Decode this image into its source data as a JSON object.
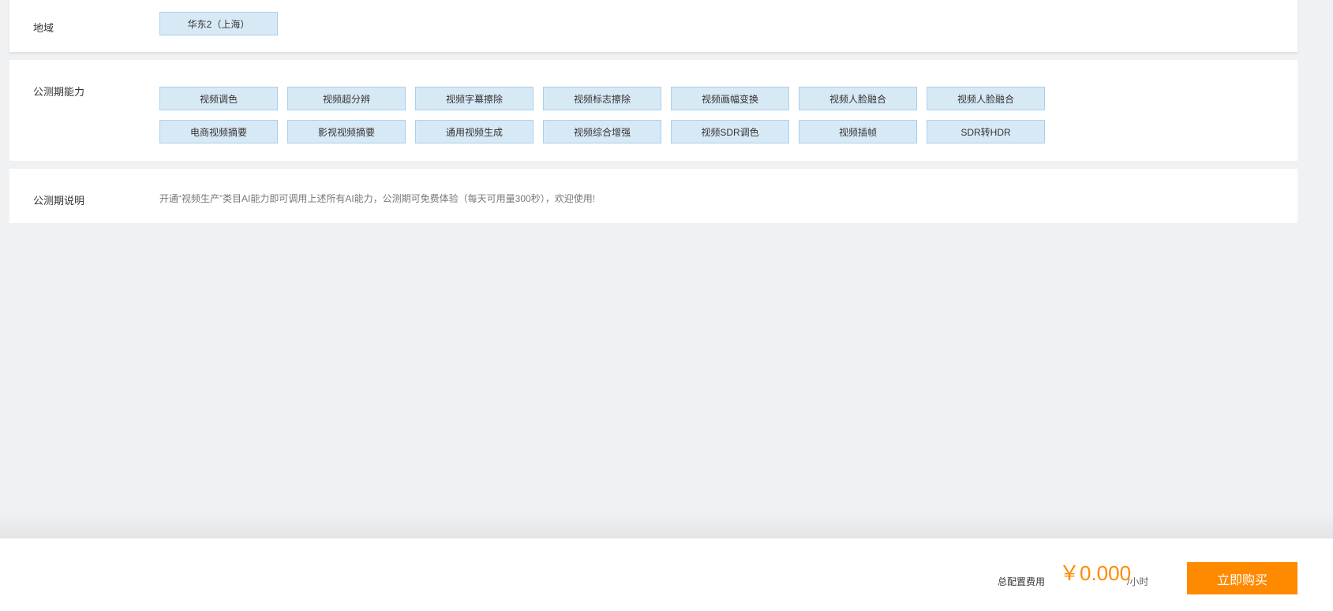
{
  "region": {
    "label": "地域",
    "selected": "华东2（上海）"
  },
  "abilities": {
    "label": "公测期能力",
    "options": [
      "视频调色",
      "视频超分辨",
      "视频字幕擦除",
      "视频标志擦除",
      "视频画幅变换",
      "视频人脸融合",
      "视频人脸融合",
      "电商视频摘要",
      "影视视频摘要",
      "通用视频生成",
      "视频综合增强",
      "视频SDR调色",
      "视频插帧",
      "SDR转HDR"
    ]
  },
  "notice": {
    "label": "公测期说明",
    "text": "开通“视频生产”类目AI能力即可调用上述所有AI能力，公测期可免费体验（每天可用量300秒），欢迎使用!"
  },
  "footer": {
    "total_label": "总配置费用",
    "price": "￥0.000",
    "unit": "/小时",
    "buy_label": "立即购买"
  },
  "colors": {
    "accent": "#ff8a00",
    "option_bg": "#d8e9f6",
    "option_border": "#a9d0ee",
    "page_bg": "#f0f1f3"
  }
}
